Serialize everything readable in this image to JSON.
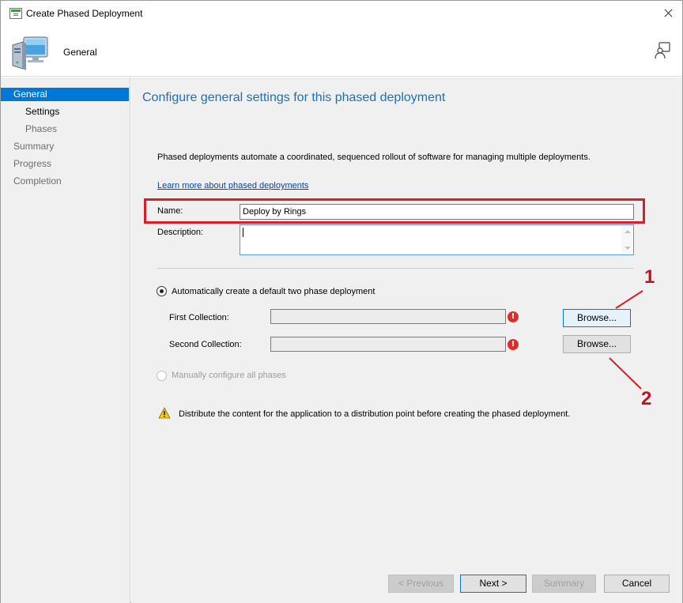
{
  "window": {
    "title": "Create Phased Deployment",
    "header_title": "General"
  },
  "nav": {
    "items": [
      {
        "label": "General"
      },
      {
        "label": "Settings"
      },
      {
        "label": "Phases"
      },
      {
        "label": "Summary"
      },
      {
        "label": "Progress"
      },
      {
        "label": "Completion"
      }
    ]
  },
  "main": {
    "heading": "Configure general settings for this phased deployment",
    "description": "Phased deployments automate a coordinated, sequenced rollout of software for managing multiple deployments.",
    "learn_more": "Learn more about phased deployments",
    "name_label": "Name:",
    "name_value": "Deploy by Rings",
    "description_label": "Description:",
    "description_value": "",
    "option_auto": "Automatically create a default two phase deployment",
    "first_collection_label": "First Collection:",
    "first_collection_value": "",
    "second_collection_label": "Second Collection:",
    "second_collection_value": "",
    "browse_label": "Browse...",
    "option_manual": "Manually configure all phases",
    "warning": "Distribute the content for the application to a distribution point before creating the phased deployment.",
    "auto_selected": true,
    "manual_enabled": false
  },
  "annotations": [
    "1",
    "2"
  ],
  "footer": {
    "previous": "< Previous",
    "next": "Next >",
    "summary": "Summary",
    "cancel": "Cancel"
  },
  "colors": {
    "accent": "#0078d7",
    "heading": "#1e6fb4",
    "highlight": "#d61f2c",
    "error": "#d8302a",
    "warning": "#f2c811"
  }
}
